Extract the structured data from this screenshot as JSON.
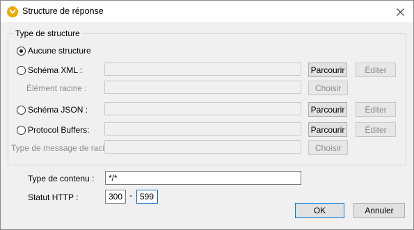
{
  "window": {
    "title": "Structure de réponse"
  },
  "icons": {
    "app": "altova-app-icon",
    "close": "close-icon"
  },
  "group": {
    "label": "Type de structure",
    "options": {
      "none": "Aucune structure",
      "xml": "Schéma XML :",
      "json": "Schéma JSON :",
      "protobuf": "Protocol Buffers:"
    },
    "root_element_label": "Élément racine :",
    "root_message_label": "Type de message de racine",
    "browse_label": "Parcourir",
    "edit_label": "Éditer",
    "choose_label": "Choisir",
    "selected": "none"
  },
  "content_type": {
    "label": "Type de contenu :",
    "value": "*/*"
  },
  "http_status": {
    "label": "Statut HTTP :",
    "from": "300",
    "separator": "-",
    "to": "599"
  },
  "footer": {
    "ok_label": "OK",
    "cancel_label": "Annuler"
  },
  "colors": {
    "accent": "#0078d7",
    "app_icon": "#f2a900"
  }
}
